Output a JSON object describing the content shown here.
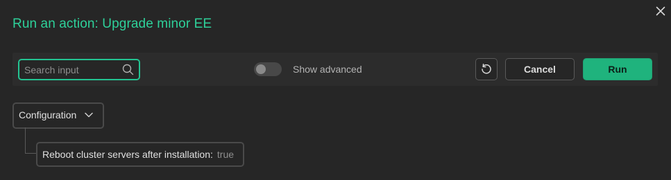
{
  "dialog": {
    "title": "Run an action: Upgrade minor EE",
    "close_icon": "close-icon"
  },
  "toolbar": {
    "search": {
      "placeholder": "Search input",
      "value": "",
      "icon": "search-icon"
    },
    "show_advanced": {
      "label": "Show advanced",
      "enabled": false
    },
    "reset_icon": "reset-icon",
    "cancel_label": "Cancel",
    "run_label": "Run"
  },
  "tree": {
    "group_label": "Configuration",
    "group_icon": "chevron-down-icon",
    "params": [
      {
        "label": "Reboot cluster servers after installation:",
        "value": "true"
      }
    ]
  },
  "colors": {
    "accent": "#2ed19a",
    "run_button": "#1fb37d",
    "background": "#262626",
    "toolbar": "#2c2c2c"
  }
}
